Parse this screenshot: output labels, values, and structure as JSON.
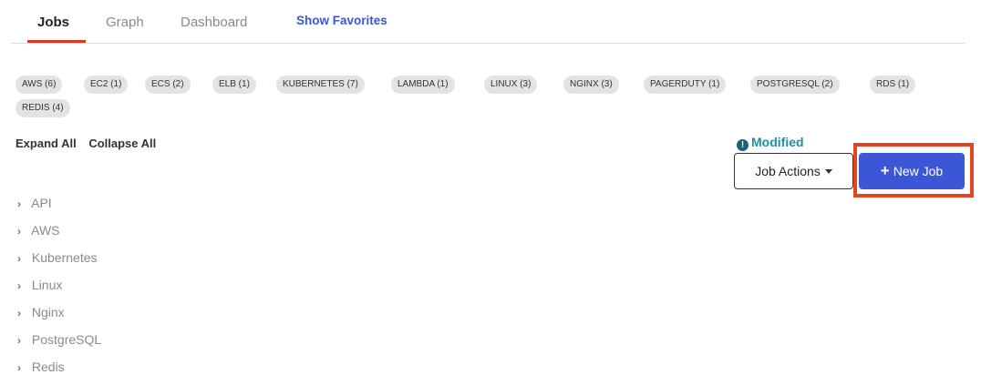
{
  "tabs": [
    {
      "label": "Jobs",
      "active": true
    },
    {
      "label": "Graph",
      "active": false
    },
    {
      "label": "Dashboard",
      "active": false
    },
    {
      "label": "Show Favorites",
      "active": false
    }
  ],
  "tags": [
    "AWS (6)",
    "EC2 (1)",
    "ECS (2)",
    "ELB (1)",
    "KUBERNETES (7)",
    "LAMBDA (1)",
    "LINUX (3)",
    "NGINX (3)",
    "PAGERDUTY (1)",
    "POSTGRESQL (2)",
    "RDS (1)",
    "REDIS (4)"
  ],
  "controls": {
    "expand_all": "Expand All",
    "collapse_all": "Collapse All",
    "modified": "Modified",
    "job_actions": "Job Actions",
    "new_job": "New Job"
  },
  "tree": [
    "API",
    "AWS",
    "Kubernetes",
    "Linux",
    "Nginx",
    "PostgreSQL",
    "Redis"
  ],
  "colors": {
    "accent_blue": "#3b57d6",
    "active_tab_underline": "#d9391f",
    "highlight_frame": "#e0461f",
    "modified_teal": "#1f8fa6"
  },
  "icons": {
    "info": "info-icon",
    "caret": "caret-down-icon",
    "plus": "plus-icon",
    "chevron": "chevron-right-icon"
  }
}
